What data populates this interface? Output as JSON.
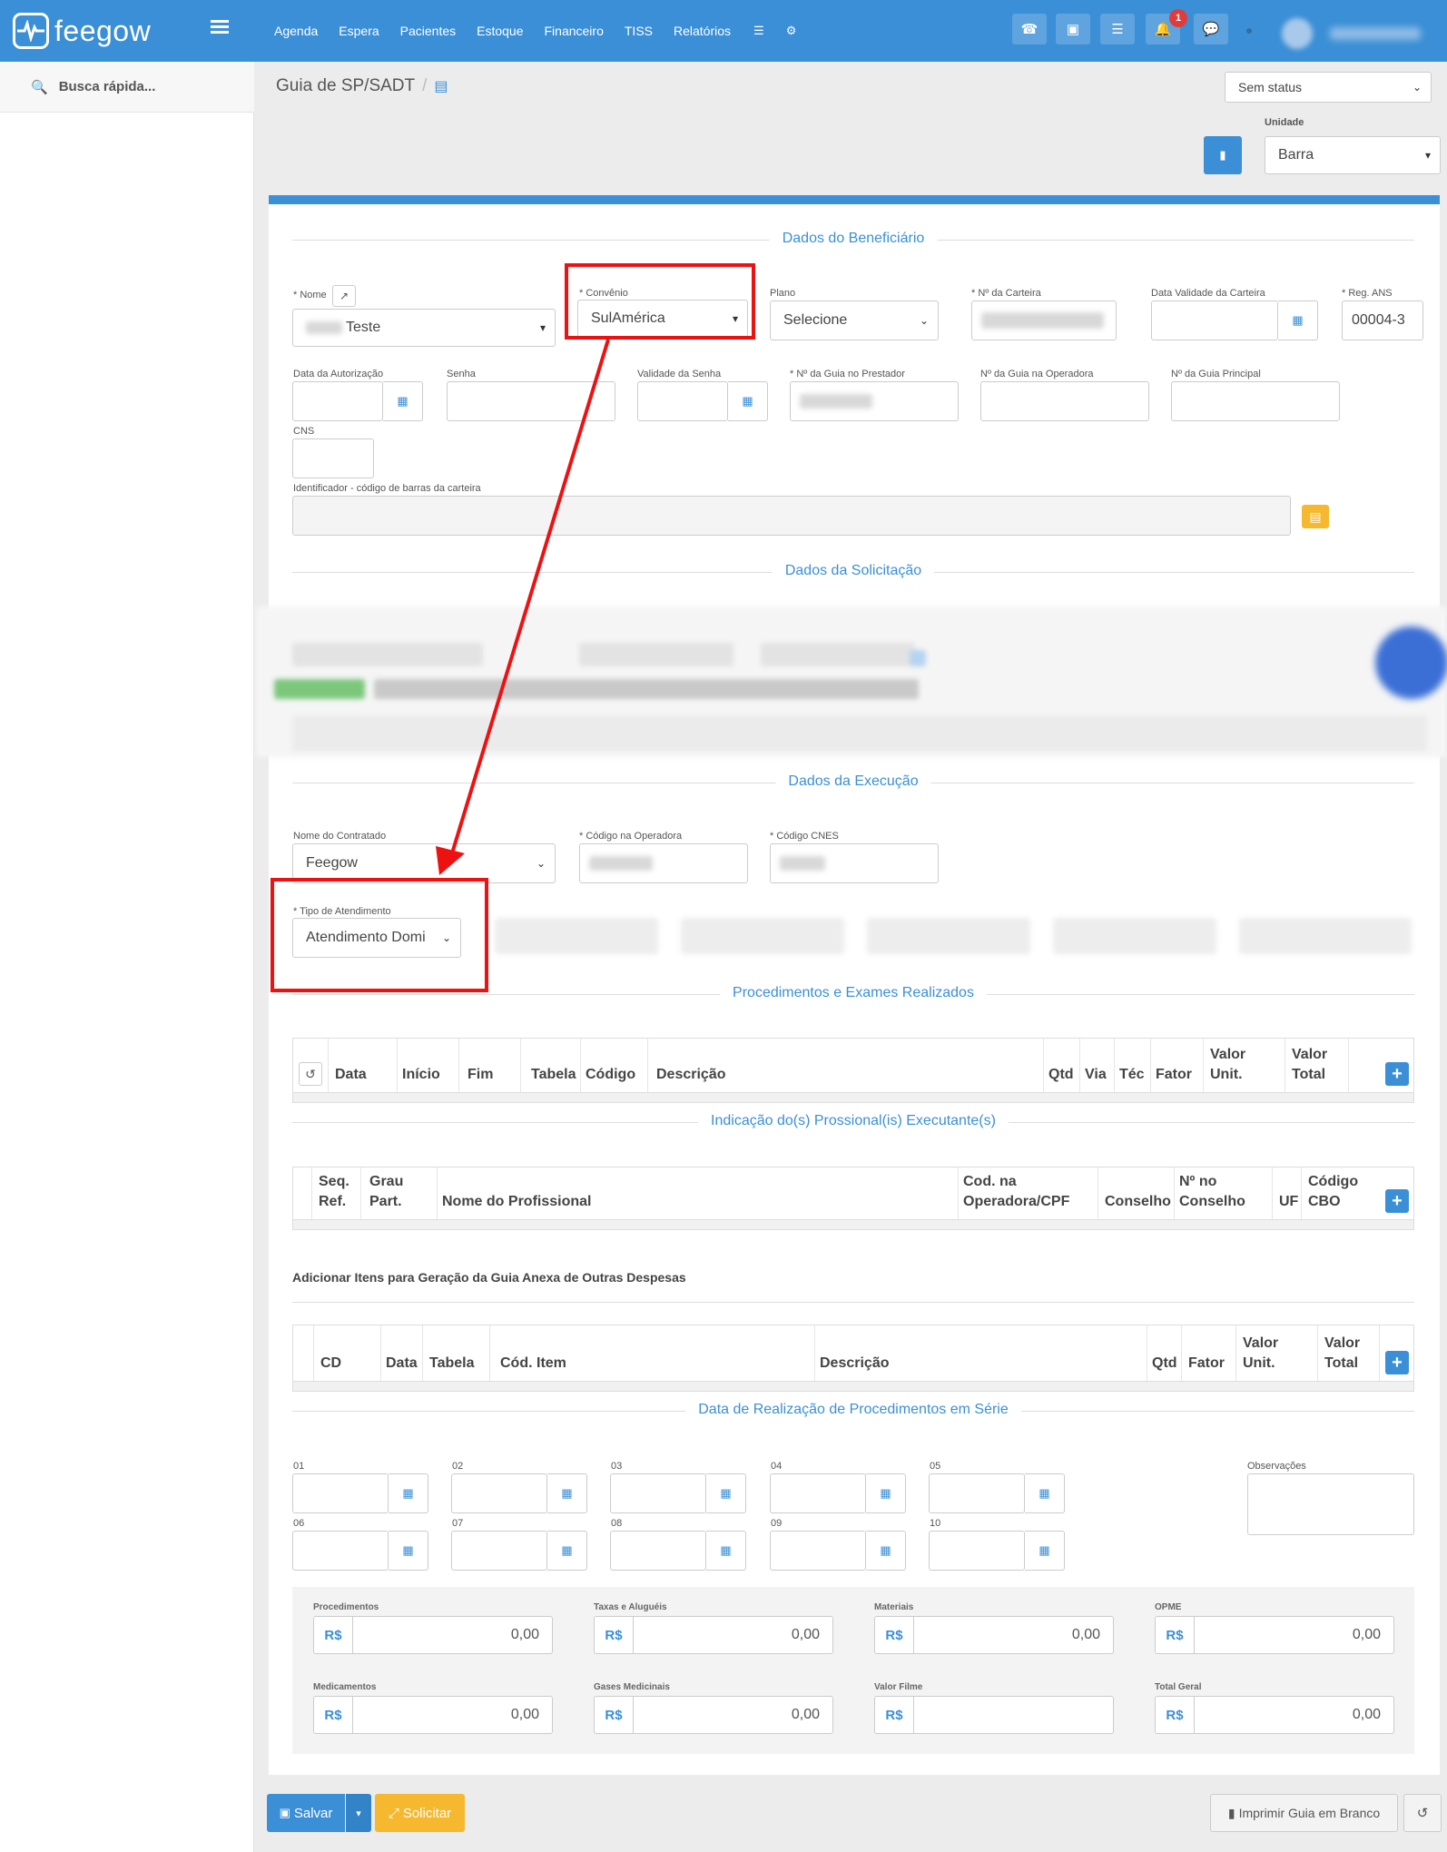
{
  "topbar": {
    "logo_text": "feegow",
    "nav": [
      "Agenda",
      "Espera",
      "Pacientes",
      "Estoque",
      "Financeiro",
      "TISS",
      "Relatórios"
    ],
    "notification_count": "1"
  },
  "sidebar": {
    "search_label": "Busca rápida..."
  },
  "header": {
    "title": "Guia de SP/SADT",
    "status_value": "Sem status",
    "unidade_label": "Unidade",
    "unidade_value": "Barra"
  },
  "beneficiario": {
    "section_title": "Dados do Beneficiário",
    "nome_label": "* Nome",
    "nome_value": "Teste",
    "convenio_label": "* Convênio",
    "convenio_value": "SulAmérica",
    "plano_label": "Plano",
    "plano_value": "Selecione",
    "carteira_label": "* Nº da Carteira",
    "validade_carteira_label": "Data Validade da Carteira",
    "reg_ans_label": "* Reg. ANS",
    "reg_ans_value": "00004-3",
    "data_autorizacao_label": "Data da Autorização",
    "senha_label": "Senha",
    "validade_senha_label": "Validade da Senha",
    "guia_prestador_label": "* Nº da Guia no Prestador",
    "guia_operadora_label": "Nº da Guia na Operadora",
    "guia_principal_label": "Nº da Guia Principal",
    "cns_label": "CNS",
    "identificador_label": "Identificador - código de barras da carteira"
  },
  "solicitacao": {
    "section_title": "Dados da Solicitação"
  },
  "execucao": {
    "section_title": "Dados da Execução",
    "contratado_label": "Nome do Contratado",
    "contratado_value": "Feegow",
    "codigo_operadora_label": "* Código na Operadora",
    "cnes_label": "* Código CNES",
    "tipo_atendimento_label": "* Tipo de Atendimento",
    "tipo_atendimento_value": "Atendimento Domi"
  },
  "procedimentos": {
    "section_title": "Procedimentos e Exames Realizados",
    "columns": [
      "Data",
      "Início",
      "Fim",
      "Tabela",
      "Código",
      "Descrição",
      "Qtd",
      "Via",
      "Téc",
      "Fator",
      "Valor Unit.",
      "Valor Total"
    ]
  },
  "profissionais": {
    "section_title": "Indicação do(s) Prossional(is) Executante(s)",
    "columns": [
      "Seq. Ref.",
      "Grau Part.",
      "Nome do Profissional",
      "Cod. na Operadora/CPF",
      "Conselho",
      "Nº no Conselho",
      "UF",
      "Código CBO"
    ]
  },
  "outras_despesas": {
    "title": "Adicionar Itens para Geração da Guia Anexa de Outras Despesas",
    "columns": [
      "CD",
      "Data",
      "Tabela",
      "Cód. Item",
      "Descrição",
      "Qtd",
      "Fator",
      "Valor Unit.",
      "Valor Total"
    ]
  },
  "serie": {
    "section_title": "Data de Realização de Procedimentos em Série",
    "dates": [
      "01",
      "02",
      "03",
      "04",
      "05",
      "06",
      "07",
      "08",
      "09",
      "10"
    ],
    "observacoes_label": "Observações"
  },
  "totais": {
    "currency": "R$",
    "items": [
      {
        "label": "Procedimentos",
        "value": "0,00"
      },
      {
        "label": "Taxas e Aluguéis",
        "value": "0,00"
      },
      {
        "label": "Materiais",
        "value": "0,00"
      },
      {
        "label": "OPME",
        "value": "0,00"
      },
      {
        "label": "Medicamentos",
        "value": "0,00"
      },
      {
        "label": "Gases Medicinais",
        "value": "0,00"
      },
      {
        "label": "Valor Filme",
        "value": ""
      },
      {
        "label": "Total Geral",
        "value": "0,00"
      }
    ]
  },
  "footer": {
    "save_label": "Salvar",
    "solicitar_label": "Solicitar",
    "print_label": "Imprimir Guia em Branco"
  },
  "colors": {
    "primary": "#3b8fd6",
    "annotation": "#ee1111",
    "warning": "#f5b82e"
  }
}
